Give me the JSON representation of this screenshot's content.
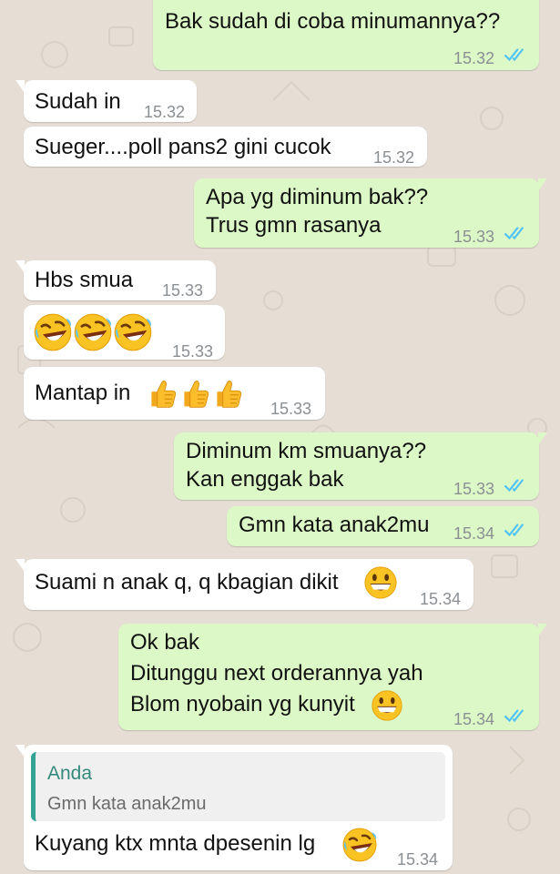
{
  "conversation": {
    "messages": [
      {
        "dir": "out",
        "text": "Bak sudah di coba minumannya??",
        "time": "15.32",
        "status": "read"
      },
      {
        "dir": "in",
        "text": "Sudah in",
        "time": "15.32"
      },
      {
        "dir": "in",
        "text": "Sueger....poll pans2 gini cucok",
        "time": "15.32"
      },
      {
        "dir": "out",
        "text": "Apa yg diminum bak??\nTrus gmn rasanya",
        "time": "15.33",
        "status": "read"
      },
      {
        "dir": "in",
        "text": "Hbs smua",
        "time": "15.33"
      },
      {
        "dir": "in",
        "text": "",
        "emoji": [
          "rolling-laughing-emoji",
          "rolling-laughing-emoji",
          "rolling-laughing-emoji"
        ],
        "time": "15.33"
      },
      {
        "dir": "in",
        "text": "Mantap in",
        "emoji": [
          "thumbs-up-emoji",
          "thumbs-up-emoji",
          "thumbs-up-emoji"
        ],
        "time": "15.33"
      },
      {
        "dir": "out",
        "text": "Diminum km smuanya??\nKan enggak bak",
        "time": "15.33",
        "status": "read"
      },
      {
        "dir": "out",
        "text": "Gmn kata anak2mu",
        "time": "15.34",
        "status": "read"
      },
      {
        "dir": "in",
        "text": "Suami n anak q, q kbagian dikit",
        "emoji": [
          "grinning-face-emoji"
        ],
        "time": "15.34"
      },
      {
        "dir": "out",
        "text": "Ok bak\nDitunggu next orderannya yah\nBlom nyobain yg kunyit",
        "emoji": [
          "grinning-face-emoji"
        ],
        "time": "15.34",
        "status": "read"
      },
      {
        "dir": "in",
        "reply_to": {
          "name": "Anda",
          "text": "Gmn kata anak2mu"
        },
        "text": "Kuyang ktx mnta dpesenin lg",
        "emoji": [
          "rolling-laughing-emoji"
        ],
        "time": "15.34"
      }
    ]
  },
  "colors": {
    "outgoing_bubble": "#dcf8c6",
    "incoming_bubble": "#ffffff",
    "chat_background": "#e6ddd4",
    "read_ticks": "#4fc3f7",
    "reply_accent": "#34a394",
    "timestamp": "#8a8f93"
  },
  "icons": {
    "read_receipt": "double-check-icon"
  }
}
